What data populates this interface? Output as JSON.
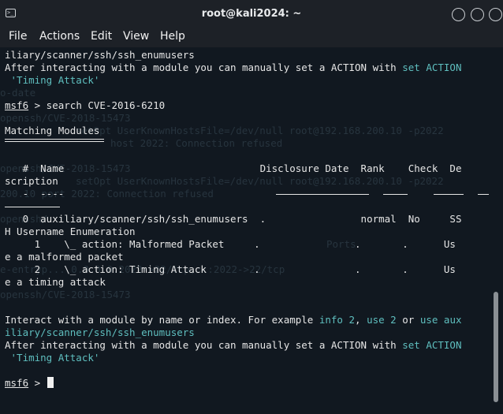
{
  "window": {
    "title": "root@kali2024: ~"
  },
  "menu": [
    "File",
    "Actions",
    "Edit",
    "View",
    "Help"
  ],
  "ghost_lines": [
    "o-date",
    "openssh/CVE-2018-15473",
    "setOpt UserKnownHostsFile=/dev/null root@192.168.200.10 -p2022",
    "host 2022: Connection refused",
    "openssh/CVE-2018-15473",
    "setOpt UserKnownHostsFile=/dev/null root@192.168.200.10 -p2022",
    "200.10 port 2022: Connection refused",
    "openssh/",
    "Ports",
    "e-entryp... 0.0.0.0:2022->22/tcp,:::2022->22/tcp",
    "openssh/CVE-2018-15473"
  ],
  "term": {
    "l1": "iliary/scanner/ssh/ssh_enumusers",
    "l2a": "After interacting with a module you can manually set a ACTION with ",
    "l2b": "set ACTION",
    "l3": " 'Timing Attack'",
    "prompt": "msf6",
    "l4cmd": " > search CVE-2016-6210",
    "matching": "Matching Modules",
    "hdr": "   #  Name                                 Disclosure Date  Rank    Check  De",
    "hdr2": "scription",
    "dash_line": "   -  ----",
    "r0": "   0  auxiliary/scanner/ssh/ssh_enumusers  .                normal  No     SS",
    "r0b": "H Username Enumeration",
    "r1": "     1    \\_ action: Malformed Packet     .                .       .      Us",
    "r1b": "e a malformed packet",
    "r2": "     2    \\_ action: Timing Attack        .                .       .      Us",
    "r2b": "e a timing attack",
    "i1a": "Interact with a module by name or index. For example ",
    "i1b": "info 2",
    "i1c": ", ",
    "i1d": "use 2",
    "i1e": " or ",
    "i1f": "use aux",
    "i2": "iliary/scanner/ssh/ssh_enumusers",
    "i3a": "After interacting with a module you can manually set a ACTION with ",
    "i3b": "set ACTION",
    "i4": " 'Timing Attack'",
    "final_prompt": "msf6",
    "final_rest": " > "
  }
}
